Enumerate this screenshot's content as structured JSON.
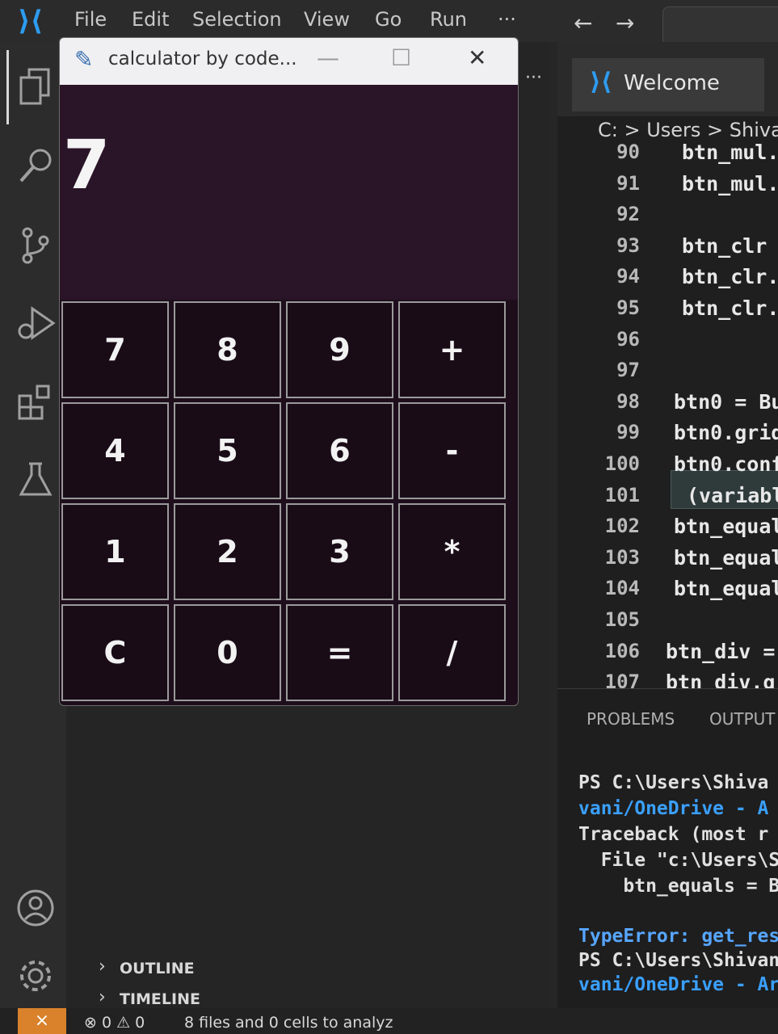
{
  "menubar": {
    "items": [
      "File",
      "Edit",
      "Selection",
      "View",
      "Go",
      "Run"
    ],
    "more": "···",
    "back": "←",
    "forward": "→"
  },
  "calculator": {
    "title": "calculator by code...",
    "controls": {
      "minimize": "—",
      "maximize": "☐",
      "close": "✕"
    },
    "display": "7",
    "keys": [
      [
        "7",
        "8",
        "9",
        "+"
      ],
      [
        "4",
        "5",
        "6",
        "-"
      ],
      [
        "1",
        "2",
        "3",
        "*"
      ],
      [
        "C",
        "0",
        "=",
        "/"
      ]
    ]
  },
  "editor": {
    "tab_more": "···",
    "tab": "Welcome",
    "breadcrumb": "C: > Users > Shivan",
    "lines": [
      {
        "no": "90",
        "code": "btn_mul."
      },
      {
        "no": "91",
        "code": "btn_mul."
      },
      {
        "no": "92",
        "code": ""
      },
      {
        "no": "93",
        "code": "btn_clr"
      },
      {
        "no": "94",
        "code": "btn_clr."
      },
      {
        "no": "95",
        "code": "btn_clr."
      },
      {
        "no": "96",
        "code": ""
      },
      {
        "no": "97",
        "code": ""
      },
      {
        "no": "98",
        "code": "btn0 = Bu"
      },
      {
        "no": "99",
        "code": "btn0.grid"
      },
      {
        "no": "100",
        "code": "btn0.conf"
      },
      {
        "no": "101",
        "code": "(variabl"
      },
      {
        "no": "102",
        "code": "btn_equal"
      },
      {
        "no": "103",
        "code": "btn_equal"
      },
      {
        "no": "104",
        "code": "btn_equal"
      },
      {
        "no": "105",
        "code": ""
      },
      {
        "no": "106",
        "code": "btn_div ="
      },
      {
        "no": "107",
        "code": "btn_div.gr"
      }
    ]
  },
  "panel": {
    "tabs": [
      "PROBLEMS",
      "OUTPUT"
    ],
    "terminal": [
      "PS C:\\Users\\Shiva",
      "vani/OneDrive - A",
      "Traceback (most r",
      "  File \"c:\\Users\\S",
      "    btn_equals = B",
      "",
      "TypeError: get_res",
      "PS C:\\Users\\Shivan",
      "vani/OneDrive - Ar"
    ]
  },
  "sidebar": {
    "sections": [
      "OUTLINE",
      "TIMELINE"
    ]
  },
  "statusbar": {
    "problems": "⊗ 0 ⚠ 0",
    "analysis": "8 files and 0 cells to analyz"
  },
  "colors": {
    "accent_blue": "#2d9cf0",
    "remote_orange": "#d9822b",
    "calc_background": "#1e0e1c"
  }
}
